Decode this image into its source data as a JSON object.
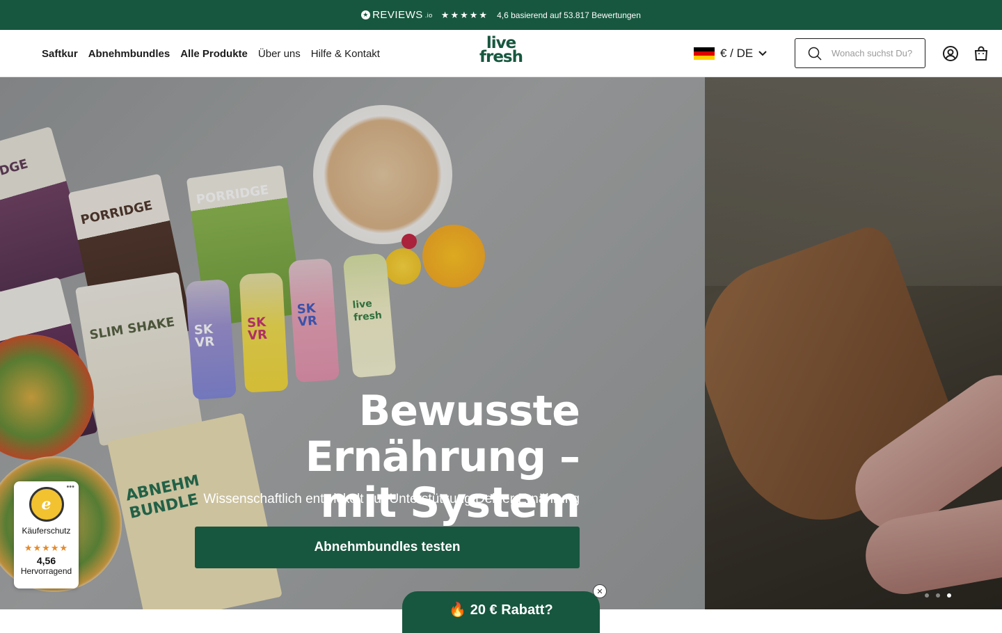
{
  "announcement": {
    "reviews_brand": "REVIEWS",
    "reviews_brand_suffix": ".io",
    "stars": "★★★★★",
    "rating_text": "4,6 basierend auf 53.817 Bewertungen"
  },
  "header": {
    "nav": [
      "Saftkur",
      "Abnehmbundles",
      "Alle Produkte",
      "Über uns",
      "Hilfe & Kontakt"
    ],
    "logo_line1": "live",
    "logo_line2": "fresh",
    "locale": "€ / DE",
    "search_placeholder": "Wonach suchst Du?",
    "icons": [
      "search-icon",
      "account-icon",
      "cart-icon",
      "chevron-down-icon"
    ]
  },
  "hero": {
    "title_line1": "Bewusste Ernährung –",
    "title_line2": "mit System",
    "subtitle": "Wissenschaftlich entwickelt zur Unterstützung Deiner Ernährung",
    "cta_label": "Abnehmbundles testen",
    "packs": [
      "RRIDGE",
      "PORRIDGE",
      "PORRIDGE",
      "SLIM SHAKE",
      "ABNEHM BUNDLE"
    ],
    "bottles": [
      "SK VR",
      "SK VR",
      "SK VR",
      "live fresh"
    ],
    "slide_count": 3,
    "active_slide": 3
  },
  "trust_badge": {
    "title": "Käuferschutz",
    "stars": "★★★★★",
    "score": "4,56",
    "rating_label": "Hervorragend",
    "menu": "•••"
  },
  "promo": {
    "label": "🔥 20 € Rabatt?",
    "close": "✕"
  },
  "colors": {
    "brand_green": "#17573f",
    "trust_star": "#e48b2a"
  }
}
